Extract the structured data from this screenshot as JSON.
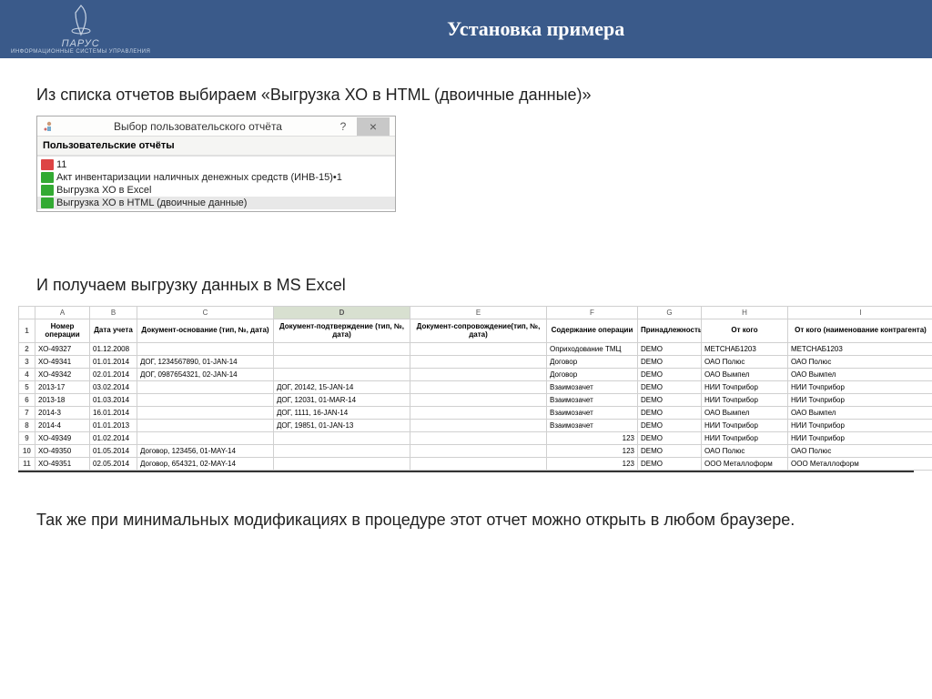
{
  "header": {
    "logo_brand": "ПАРУС",
    "logo_sub": "ИНФОРМАЦИОННЫЕ СИСТЕМЫ УПРАВЛЕНИЯ",
    "title": "Установка примера"
  },
  "text1": "Из списка отчетов выбираем «Выгрузка ХО в HTML (двоичные данные)»",
  "dialog": {
    "title": "Выбор пользовательского отчёта",
    "help": "?",
    "close": "×",
    "section": "Пользовательские отчёты",
    "items": [
      "11",
      "Акт инвентаризации наличных денежных средств (ИНВ-15)•1",
      "Выгрузка ХО в Excel",
      "Выгрузка ХО в HTML (двоичные данные)"
    ]
  },
  "text2": "И получаем выгрузку данных в MS Excel",
  "excel": {
    "cols": [
      "",
      "A",
      "B",
      "C",
      "D",
      "E",
      "F",
      "G",
      "H",
      "I"
    ],
    "headers": [
      "",
      "Номер операции",
      "Дата учета",
      "Документ-основание (тип, №, дата)",
      "Документ-подтверждение (тип, №, дата)",
      "Документ-сопровождение(тип, №, дата)",
      "Содержание операции",
      "Принадлежность",
      "От кого",
      "От кого (наименование контрагента)"
    ],
    "rows": [
      {
        "n": "2",
        "a": "ХО-49327",
        "b": "01.12.2008",
        "c": "",
        "d": "",
        "e": "",
        "f": "Оприходование ТМЦ",
        "g": "DEMO",
        "h": "МЕТСНАБ1203",
        "i": "МЕТСНАБ1203"
      },
      {
        "n": "3",
        "a": "ХО-49341",
        "b": "01.01.2014",
        "c": "ДОГ, 1234567890, 01-JAN-14",
        "d": "",
        "e": "",
        "f": "Договор",
        "g": "DEMO",
        "h": "ОАО Полюс",
        "i": "ОАО Полюс"
      },
      {
        "n": "4",
        "a": "ХО-49342",
        "b": "02.01.2014",
        "c": "ДОГ, 0987654321, 02-JAN-14",
        "d": "",
        "e": "",
        "f": "Договор",
        "g": "DEMO",
        "h": "ОАО Вымпел",
        "i": "ОАО Вымпел"
      },
      {
        "n": "5",
        "a": "2013-17",
        "b": "03.02.2014",
        "c": "",
        "d": "ДОГ, 20142, 15-JAN-14",
        "e": "",
        "f": "Взаимозачет",
        "g": "DEMO",
        "h": "НИИ Точприбор",
        "i": "НИИ Точприбор"
      },
      {
        "n": "6",
        "a": "2013-18",
        "b": "01.03.2014",
        "c": "",
        "d": "ДОГ, 12031, 01-MAR-14",
        "e": "",
        "f": "Взаимозачет",
        "g": "DEMO",
        "h": "НИИ Точприбор",
        "i": "НИИ Точприбор"
      },
      {
        "n": "7",
        "a": "2014-3",
        "b": "16.01.2014",
        "c": "",
        "d": "ДОГ, 1111, 16-JAN-14",
        "e": "",
        "f": "Взаимозачет",
        "g": "DEMO",
        "h": "ОАО Вымпел",
        "i": "ОАО Вымпел"
      },
      {
        "n": "8",
        "a": "2014-4",
        "b": "01.01.2013",
        "c": "",
        "d": "ДОГ, 19851, 01-JAN-13",
        "e": "",
        "f": "Взаимозачет",
        "g": "DEMO",
        "h": "НИИ Точприбор",
        "i": "НИИ Точприбор"
      },
      {
        "n": "9",
        "a": "ХО-49349",
        "b": "01.02.2014",
        "c": "",
        "d": "",
        "e": "",
        "f": "123",
        "g": "DEMO",
        "h": "НИИ Точприбор",
        "i": "НИИ Точприбор"
      },
      {
        "n": "10",
        "a": "ХО-49350",
        "b": "01.05.2014",
        "c": "Договор, 123456, 01-MAY-14",
        "d": "",
        "e": "",
        "f": "123",
        "g": "DEMO",
        "h": "ОАО Полюс",
        "i": "ОАО Полюс"
      },
      {
        "n": "11",
        "a": "ХО-49351",
        "b": "02.05.2014",
        "c": "Договор, 654321, 02-MAY-14",
        "d": "",
        "e": "",
        "f": "123",
        "g": "DEMO",
        "h": "ООО Металлоформ",
        "i": "ООО Металлоформ"
      }
    ]
  },
  "text3": "Так же при минимальных модификациях в процедуре этот отчет можно открыть в любом браузере."
}
